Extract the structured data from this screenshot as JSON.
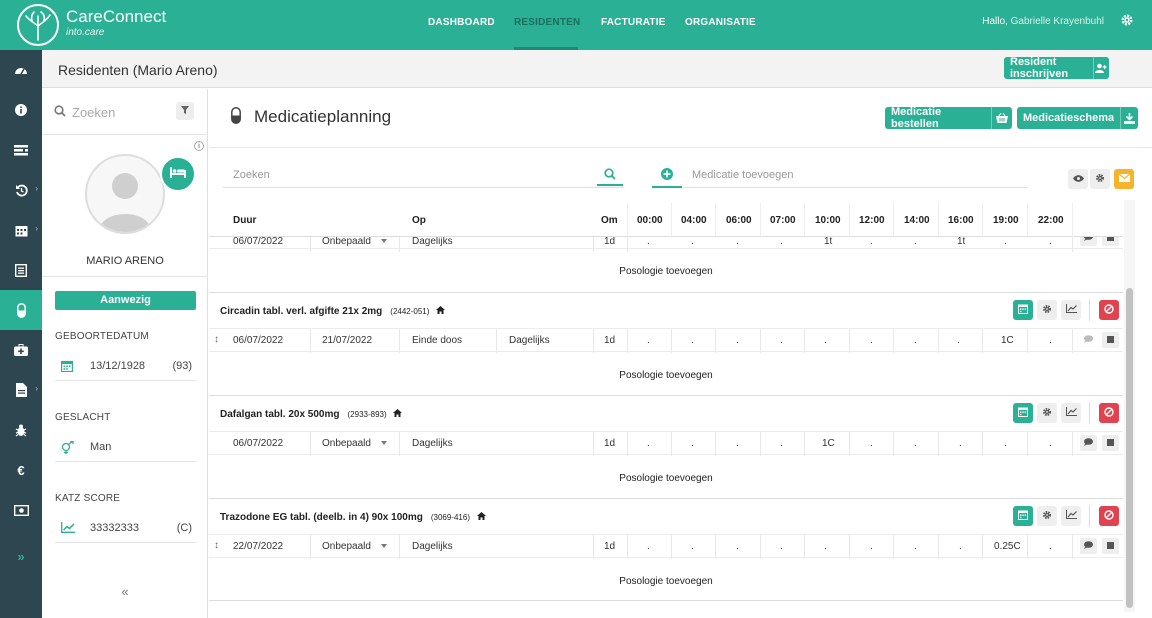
{
  "app": {
    "brand": "CareConnect",
    "brand_sub": "into.care",
    "nav": [
      {
        "label": "DASHBOARD",
        "active": false
      },
      {
        "label": "RESIDENTEN",
        "active": true
      },
      {
        "label": "FACTURATIE",
        "active": false
      },
      {
        "label": "ORGANISATIE",
        "active": false
      }
    ],
    "greeting": "Hallo,",
    "user_name": "Gabrielle Krayenbuhl"
  },
  "sidebar_icons": [
    "dashboard-icon",
    "info-icon",
    "list-icon",
    "history-icon",
    "calendar-icon",
    "checklist-icon",
    "pill-icon",
    "medkit-icon",
    "document-icon",
    "bug-icon",
    "euro-icon",
    "money-icon"
  ],
  "header": {
    "title": "Residenten (Mario Areno)",
    "enroll_button": "Resident inschrijven"
  },
  "resident": {
    "search_placeholder": "Zoeken",
    "name": "MARIO ARENO",
    "status": "Aanwezig",
    "birth_label": "GEBOORTEDATUM",
    "birth_date": "13/12/1928",
    "age": "(93)",
    "gender_label": "GESLACHT",
    "gender": "Man",
    "katz_label": "KATZ SCORE",
    "katz_value": "33332333",
    "katz_class": "(C)",
    "collapse": "«"
  },
  "main": {
    "title": "Medicatieplanning",
    "order_button": "Medicatie bestellen",
    "schema_button": "Medicatieschema",
    "search_placeholder": "Zoeken",
    "add_placeholder": "Medicatie toevoegen",
    "columns": {
      "duur": "Duur",
      "op": "Op",
      "om": "Om",
      "times": [
        "00:00",
        "04:00",
        "06:00",
        "07:00",
        "10:00",
        "12:00",
        "14:00",
        "16:00",
        "19:00",
        "22:00"
      ]
    },
    "add_posology": "Posologie toevoegen",
    "first_row": {
      "start": "06/07/2022",
      "end": "Onbepaald",
      "op": "Dagelijks",
      "om": "1d",
      "times": [
        ".",
        ".",
        ".",
        ".",
        "1t",
        ".",
        ".",
        "1t",
        ".",
        "."
      ]
    },
    "medications": [
      {
        "name": "Circadin tabl. verl. afgifte 21x 2mg",
        "code": "(2442-051)",
        "row": {
          "start": "06/07/2022",
          "end": "21/07/2022",
          "stop": "Einde doos",
          "op": "Dagelijks",
          "om": "1d",
          "times": [
            ".",
            ".",
            ".",
            ".",
            ".",
            ".",
            ".",
            ".",
            "1C",
            "."
          ]
        }
      },
      {
        "name": "Dafalgan tabl. 20x 500mg",
        "code": "(2933-893)",
        "row": {
          "start": "06/07/2022",
          "end": "Onbepaald",
          "op": "Dagelijks",
          "om": "1d",
          "times": [
            ".",
            ".",
            ".",
            ".",
            "1C",
            ".",
            ".",
            ".",
            ".",
            "."
          ]
        }
      },
      {
        "name": "Trazodone EG tabl. (deelb. in 4) 90x 100mg",
        "code": "(3069-416)",
        "row": {
          "start": "22/07/2022",
          "end": "Onbepaald",
          "op": "Dagelijks",
          "om": "1d",
          "times": [
            ".",
            ".",
            ".",
            ".",
            ".",
            ".",
            ".",
            ".",
            "0.25C",
            "."
          ]
        }
      }
    ]
  },
  "colors": {
    "accent": "#2ab094",
    "sidebar": "#2d4650",
    "danger": "#e0424f",
    "warning": "#f5b42c"
  }
}
